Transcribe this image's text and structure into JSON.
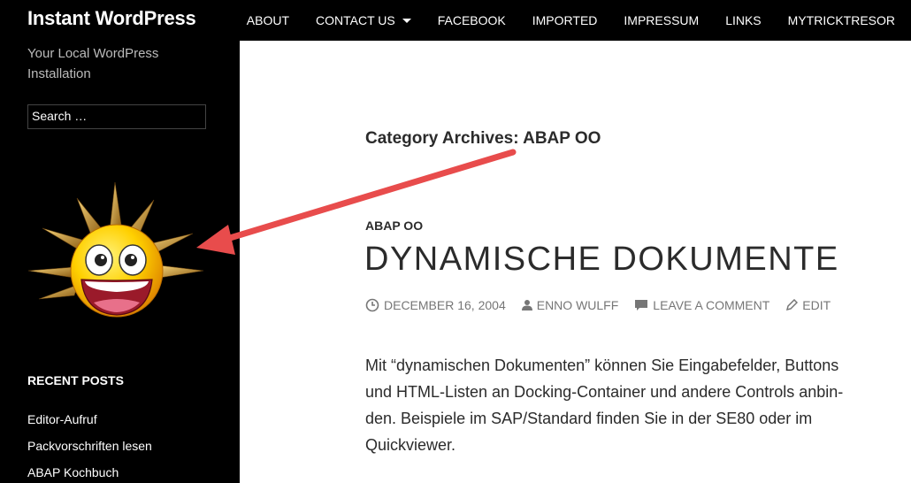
{
  "header": {
    "site_title": "Instant WordPress",
    "nav": [
      {
        "label": "ABOUT"
      },
      {
        "label": "CONTACT US"
      },
      {
        "label": "FACEBOOK"
      },
      {
        "label": "IMPORTED"
      },
      {
        "label": "IMPRESSUM"
      },
      {
        "label": "LINKS"
      },
      {
        "label": "MYTRICKTRESOR"
      }
    ]
  },
  "sidebar": {
    "tagline": "Your Local WordPress Installation",
    "search_value": "Search …",
    "smiley_image": "smiley-sun-logo",
    "recent_title": "RECENT POSTS",
    "recent_posts": [
      "Editor-Aufruf",
      "Packvorschriften lesen",
      "ABAP Kochbuch"
    ]
  },
  "main": {
    "archive_title": "Category Archives: ABAP OO",
    "category": "ABAP OO",
    "post_title": "DYNAMISCHE DOKUMENTE",
    "meta": {
      "date": "DECEMBER 16, 2004",
      "author": "ENNO WULFF",
      "comment": "LEAVE A COMMENT",
      "edit": "EDIT"
    },
    "excerpt_lines": [
      "Mit “dynamischen Dokumenten” können Sie Eingabefelder, Buttons",
      "und HTML-Listen an Docking-Container und andere Controls anbin-",
      "den. Beispiele im SAP/Standard finden Sie in der SE80 oder im",
      "Quickviewer."
    ]
  },
  "annotation": {
    "arrow_color": "#e84c4c"
  },
  "colors": {
    "header_bg": "#000000",
    "content_bg": "#ffffff",
    "text": "#2b2b2b",
    "meta": "#767676"
  }
}
